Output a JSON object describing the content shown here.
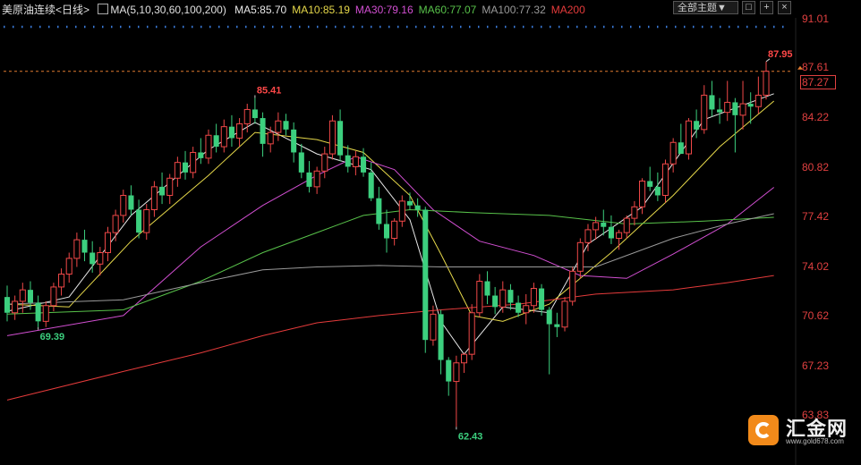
{
  "header": {
    "instrument": "美原油连续",
    "period": "<日线>",
    "ma_group": "MA(5,10,30,60,100,200)",
    "ma_values": [
      {
        "text": "MA5:85.70",
        "color": "#e8e8e8"
      },
      {
        "text": "MA10:85.19",
        "color": "#e6d84a"
      },
      {
        "text": "MA30:79.16",
        "color": "#d24fd2"
      },
      {
        "text": "MA60:77.07",
        "color": "#58c24a"
      },
      {
        "text": "MA100:77.32",
        "color": "#9a9a9a"
      },
      {
        "text": "MA200",
        "color": "#e53b3b"
      }
    ],
    "theme_select": "全部主题▼",
    "window_buttons": [
      "□",
      "+",
      "×"
    ]
  },
  "y_axis_labels": [
    "91.01",
    "87.61",
    "84.22",
    "80.82",
    "77.42",
    "74.02",
    "70.62",
    "67.23",
    "63.83"
  ],
  "last_price_box": "87.27",
  "annotations": {
    "high_1": "85.41",
    "low_1": "69.39",
    "low_2": "62.43",
    "high_2": "87.95"
  },
  "logo": {
    "name": "汇金网",
    "url": "www.gold678.com"
  },
  "colors": {
    "up": "#f04848",
    "down": "#3ccf7e",
    "bg": "#000000"
  },
  "chart_data": {
    "type": "candlestick",
    "title": "美原油连续 <日线>",
    "ylim": [
      62.5,
      91.5
    ],
    "yticks": [
      91.01,
      87.61,
      84.22,
      80.82,
      77.42,
      74.02,
      70.62,
      67.23,
      63.83
    ],
    "last_price": 87.27,
    "candles_ohlc": [
      [
        71.5,
        72.3,
        69.8,
        70.4
      ],
      [
        70.4,
        71.6,
        69.9,
        71.2
      ],
      [
        71.2,
        72.5,
        70.4,
        72.0
      ],
      [
        72.0,
        72.6,
        70.6,
        71.1
      ],
      [
        71.1,
        71.6,
        69.4,
        69.8
      ],
      [
        69.8,
        71.2,
        69.4,
        70.9
      ],
      [
        70.9,
        72.5,
        70.5,
        72.2
      ],
      [
        72.2,
        73.5,
        71.6,
        73.1
      ],
      [
        73.1,
        74.6,
        72.5,
        74.2
      ],
      [
        74.2,
        76.0,
        73.6,
        75.5
      ],
      [
        75.5,
        76.2,
        74.0,
        74.6
      ],
      [
        74.6,
        75.4,
        73.2,
        73.8
      ],
      [
        73.8,
        75.0,
        73.0,
        74.6
      ],
      [
        74.6,
        76.4,
        74.0,
        76.0
      ],
      [
        76.0,
        77.6,
        75.4,
        77.2
      ],
      [
        77.2,
        79.0,
        76.7,
        78.6
      ],
      [
        78.6,
        79.3,
        77.2,
        77.6
      ],
      [
        77.6,
        78.3,
        75.6,
        76.0
      ],
      [
        76.0,
        78.0,
        75.5,
        77.6
      ],
      [
        77.6,
        79.6,
        77.1,
        79.2
      ],
      [
        79.2,
        80.2,
        78.0,
        78.6
      ],
      [
        78.6,
        80.1,
        78.0,
        79.8
      ],
      [
        79.8,
        81.3,
        79.2,
        80.9
      ],
      [
        80.9,
        81.7,
        79.7,
        80.2
      ],
      [
        80.2,
        82.0,
        79.8,
        81.6
      ],
      [
        81.6,
        82.6,
        80.8,
        81.2
      ],
      [
        81.2,
        83.2,
        80.8,
        82.8
      ],
      [
        82.8,
        83.6,
        81.6,
        82.0
      ],
      [
        82.0,
        83.9,
        81.6,
        83.4
      ],
      [
        83.4,
        84.2,
        82.0,
        82.6
      ],
      [
        82.6,
        84.0,
        82.0,
        83.6
      ],
      [
        83.6,
        85.0,
        83.0,
        84.6
      ],
      [
        84.6,
        85.41,
        83.6,
        84.0
      ],
      [
        84.0,
        84.4,
        81.3,
        82.2
      ],
      [
        82.2,
        83.4,
        81.6,
        83.0
      ],
      [
        83.0,
        84.4,
        82.4,
        83.8
      ],
      [
        83.8,
        84.3,
        82.8,
        83.2
      ],
      [
        83.2,
        83.7,
        80.9,
        81.6
      ],
      [
        81.6,
        82.2,
        79.8,
        80.2
      ],
      [
        80.2,
        81.0,
        78.8,
        79.2
      ],
      [
        79.2,
        80.6,
        78.7,
        80.3
      ],
      [
        80.3,
        82.0,
        79.8,
        81.5
      ],
      [
        81.5,
        84.2,
        81.1,
        83.8
      ],
      [
        83.8,
        84.6,
        81.0,
        81.4
      ],
      [
        81.4,
        82.1,
        80.2,
        80.6
      ],
      [
        80.6,
        81.7,
        80.0,
        81.3
      ],
      [
        81.3,
        81.9,
        79.9,
        80.2
      ],
      [
        80.2,
        80.9,
        78.2,
        78.4
      ],
      [
        78.4,
        79.2,
        76.2,
        76.6
      ],
      [
        76.6,
        77.6,
        74.6,
        75.6
      ],
      [
        75.6,
        77.0,
        75.1,
        76.8
      ],
      [
        76.8,
        78.6,
        76.4,
        78.2
      ],
      [
        78.2,
        78.8,
        77.6,
        77.9
      ],
      [
        77.9,
        78.4,
        77.1,
        77.6
      ],
      [
        77.6,
        77.8,
        67.6,
        68.5
      ],
      [
        68.5,
        70.9,
        68.1,
        70.3
      ],
      [
        70.3,
        70.6,
        66.1,
        67.1
      ],
      [
        67.1,
        67.3,
        64.6,
        65.6
      ],
      [
        65.6,
        67.4,
        62.43,
        66.9
      ],
      [
        66.9,
        67.6,
        66.2,
        67.5
      ],
      [
        67.5,
        71.0,
        67.1,
        70.4
      ],
      [
        70.4,
        73.1,
        70.1,
        72.6
      ],
      [
        72.6,
        73.3,
        71.0,
        71.6
      ],
      [
        71.6,
        72.2,
        70.3,
        70.8
      ],
      [
        70.8,
        72.6,
        70.4,
        72.0
      ],
      [
        72.0,
        72.4,
        70.6,
        71.1
      ],
      [
        71.1,
        71.6,
        70.1,
        70.4
      ],
      [
        70.4,
        71.7,
        69.6,
        70.9
      ],
      [
        70.9,
        72.5,
        70.4,
        72.1
      ],
      [
        72.1,
        72.4,
        70.2,
        70.6
      ],
      [
        70.6,
        70.8,
        66.1,
        69.6
      ],
      [
        69.6,
        70.4,
        68.7,
        69.4
      ],
      [
        69.4,
        71.5,
        69.1,
        71.2
      ],
      [
        71.2,
        73.6,
        70.9,
        73.3
      ],
      [
        73.3,
        75.6,
        72.8,
        75.3
      ],
      [
        75.3,
        76.6,
        74.7,
        76.2
      ],
      [
        76.2,
        77.1,
        75.5,
        76.7
      ],
      [
        76.7,
        77.6,
        75.8,
        76.4
      ],
      [
        76.4,
        77.2,
        75.2,
        75.6
      ],
      [
        75.6,
        76.2,
        74.8,
        76.0
      ],
      [
        76.0,
        77.2,
        75.6,
        77.0
      ],
      [
        77.0,
        78.2,
        76.5,
        77.8
      ],
      [
        77.8,
        79.8,
        77.3,
        79.6
      ],
      [
        79.6,
        80.6,
        78.9,
        79.2
      ],
      [
        79.2,
        80.2,
        78.2,
        78.6
      ],
      [
        78.6,
        81.1,
        78.1,
        80.8
      ],
      [
        80.8,
        82.6,
        80.2,
        82.3
      ],
      [
        82.3,
        83.6,
        81.6,
        81.5
      ],
      [
        81.5,
        84.0,
        81.1,
        83.8
      ],
      [
        83.8,
        84.6,
        82.6,
        83.2
      ],
      [
        83.2,
        86.3,
        82.9,
        85.6
      ],
      [
        85.6,
        86.6,
        84.1,
        84.6
      ],
      [
        84.6,
        85.4,
        83.6,
        84.4
      ],
      [
        84.4,
        86.6,
        83.8,
        85.1
      ],
      [
        85.1,
        85.4,
        81.6,
        84.2
      ],
      [
        84.2,
        86.6,
        83.2,
        85.0
      ],
      [
        85.0,
        85.8,
        83.6,
        84.8
      ],
      [
        84.8,
        86.9,
        84.3,
        85.6
      ],
      [
        85.6,
        87.95,
        85.3,
        87.27
      ]
    ],
    "ma_lines": {
      "MA5": [
        [
          0,
          70.5
        ],
        [
          8,
          71.5
        ],
        [
          16,
          77.2
        ],
        [
          26,
          81.8
        ],
        [
          32,
          83.7
        ],
        [
          40,
          81.5
        ],
        [
          47,
          80.4
        ],
        [
          52,
          76.9
        ],
        [
          56,
          69.8
        ],
        [
          59,
          67.5
        ],
        [
          64,
          70.8
        ],
        [
          70,
          70.4
        ],
        [
          75,
          75.2
        ],
        [
          82,
          77.8
        ],
        [
          90,
          83.9
        ],
        [
          99,
          85.7
        ]
      ],
      "MA10": [
        [
          0,
          71.0
        ],
        [
          8,
          70.8
        ],
        [
          16,
          75.4
        ],
        [
          26,
          80.0
        ],
        [
          32,
          83.0
        ],
        [
          40,
          82.5
        ],
        [
          46,
          81.6
        ],
        [
          52,
          78.6
        ],
        [
          56,
          74.5
        ],
        [
          60,
          70.2
        ],
        [
          64,
          69.8
        ],
        [
          70,
          71.0
        ],
        [
          78,
          74.6
        ],
        [
          86,
          78.6
        ],
        [
          92,
          82.0
        ],
        [
          99,
          85.19
        ]
      ],
      "MA30": [
        [
          0,
          68.8
        ],
        [
          15,
          70.2
        ],
        [
          25,
          75.0
        ],
        [
          33,
          77.9
        ],
        [
          40,
          80.0
        ],
        [
          45,
          81.3
        ],
        [
          50,
          80.4
        ],
        [
          55,
          77.6
        ],
        [
          61,
          75.4
        ],
        [
          68,
          74.4
        ],
        [
          74,
          73.0
        ],
        [
          80,
          72.8
        ],
        [
          86,
          74.5
        ],
        [
          93,
          76.6
        ],
        [
          99,
          79.16
        ]
      ],
      "MA60": [
        [
          0,
          70.3
        ],
        [
          15,
          70.6
        ],
        [
          25,
          72.6
        ],
        [
          33,
          74.6
        ],
        [
          40,
          76.0
        ],
        [
          46,
          77.2
        ],
        [
          52,
          77.6
        ],
        [
          60,
          77.4
        ],
        [
          70,
          77.2
        ],
        [
          80,
          76.6
        ],
        [
          90,
          76.8
        ],
        [
          99,
          77.07
        ]
      ],
      "MA100": [
        [
          0,
          71.0
        ],
        [
          15,
          71.3
        ],
        [
          25,
          72.5
        ],
        [
          33,
          73.4
        ],
        [
          40,
          73.6
        ],
        [
          48,
          73.7
        ],
        [
          56,
          73.6
        ],
        [
          66,
          73.6
        ],
        [
          76,
          73.6
        ],
        [
          86,
          75.6
        ],
        [
          93,
          76.6
        ],
        [
          99,
          77.32
        ]
      ],
      "MA200": [
        [
          0,
          64.3
        ],
        [
          15,
          66.3
        ],
        [
          25,
          67.6
        ],
        [
          33,
          68.8
        ],
        [
          40,
          69.7
        ],
        [
          48,
          70.2
        ],
        [
          56,
          70.6
        ],
        [
          66,
          71.0
        ],
        [
          76,
          71.7
        ],
        [
          86,
          72.0
        ],
        [
          93,
          72.5
        ],
        [
          99,
          73.0
        ]
      ]
    },
    "ma_colors": {
      "MA5": "#e8e8e8",
      "MA10": "#e6d84a",
      "MA30": "#d24fd2",
      "MA60": "#58c24a",
      "MA100": "#9a9a9a",
      "MA200": "#e53b3b"
    }
  }
}
